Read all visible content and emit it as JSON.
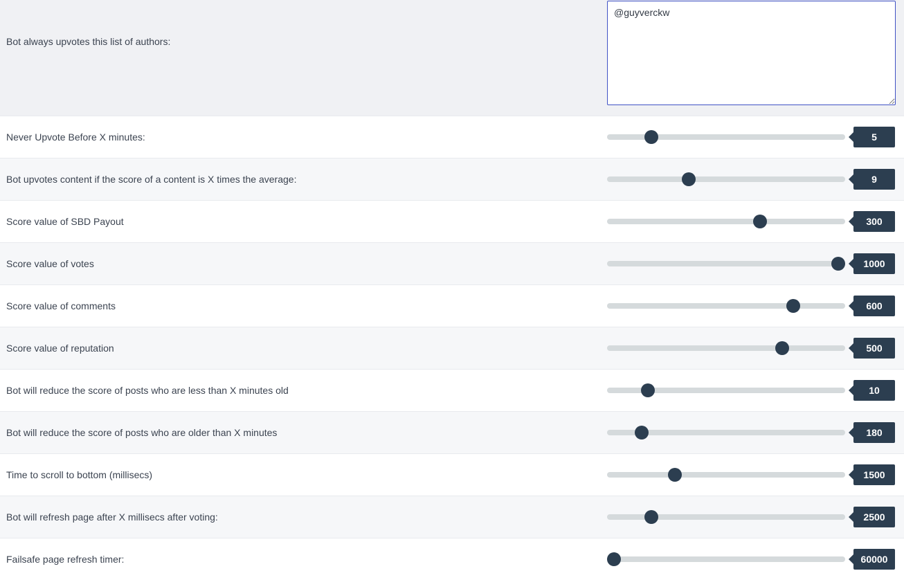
{
  "authors": {
    "label": "Bot always upvotes this list of authors:",
    "value": "@guyverckw"
  },
  "sliders": [
    {
      "label": "Never Upvote Before X minutes:",
      "value": "5",
      "fraction": 0.185
    },
    {
      "label": "Bot upvotes content if the score of a content is X times the average:",
      "value": "9",
      "fraction": 0.342
    },
    {
      "label": "Score value of SBD Payout",
      "value": "300",
      "fraction": 0.641
    },
    {
      "label": "Score value of votes",
      "value": "1000",
      "fraction": 0.971
    },
    {
      "label": "Score value of comments",
      "value": "600",
      "fraction": 0.782
    },
    {
      "label": "Score value of reputation",
      "value": "500",
      "fraction": 0.735
    },
    {
      "label": "Bot will reduce the score of posts who are less than X minutes old",
      "value": "10",
      "fraction": 0.171
    },
    {
      "label": "Bot will reduce the score of posts who are older than X minutes",
      "value": "180",
      "fraction": 0.145
    },
    {
      "label": "Time to scroll to bottom (millisecs)",
      "value": "1500",
      "fraction": 0.284
    },
    {
      "label": "Bot will refresh page after X millisecs after voting:",
      "value": "2500",
      "fraction": 0.185
    },
    {
      "label": "Failsafe page refresh timer:",
      "value": "60000",
      "fraction": 0.029
    }
  ]
}
